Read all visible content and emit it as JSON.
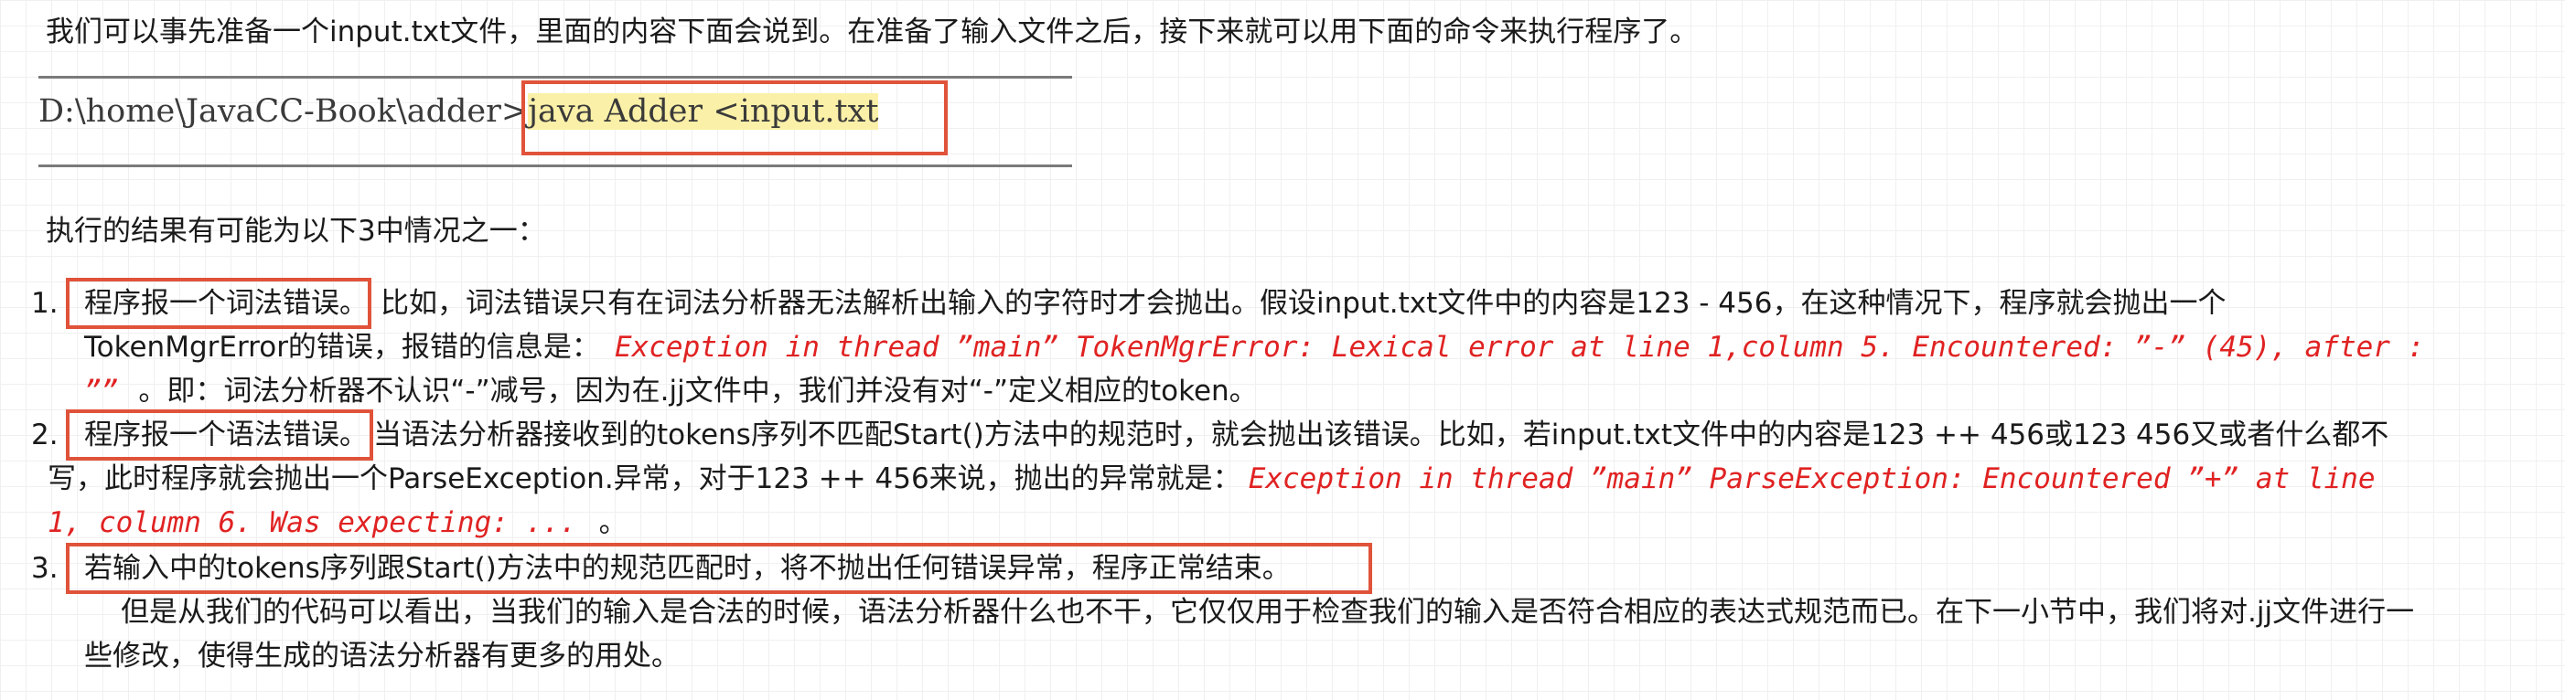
{
  "intro": "我们可以事先准备一个input.txt文件，里面的内容下面会说到。在准备了输入文件之后，接下来就可以用下面的命令来执行程序了。",
  "command": {
    "path": "D:\\home\\JavaCC-Book\\adder>",
    "cmd": "java Adder",
    "arg": "<input.txt"
  },
  "result_intro": "执行的结果有可能为以下3中情况之一：",
  "items": [
    {
      "num": "1.",
      "title": "程序报一个词法错误。",
      "line1": "比如，词法错误只有在词法分析器无法解析出输入的字符时才会抛出。假设input.txt文件中的内容是123 - 456，在这种情况下，程序就会抛出一个",
      "line2_prefix": "TokenMgrError的错误，报错的信息是：",
      "line2_err": "Exception in thread ”main” TokenMgrError: Lexical error at line 1,column 5. Encountered: ”-” (45), after :",
      "line3_err": "””",
      "line3_suffix": "。即：词法分析器不认识“-”减号，因为在.jj文件中，我们并没有对“-”定义相应的token。"
    },
    {
      "num": "2.",
      "title": "程序报一个语法错误。",
      "line1": "当语法分析器接收到的tokens序列不匹配Start()方法中的规范时，就会抛出该错误。比如，若input.txt文件中的内容是123 ++ 456或123 456又或者什么都不",
      "line2_prefix": "写，此时程序就会抛出一个ParseException.异常，对于123 ++ 456来说，抛出的异常就是：",
      "line2_err": "Exception in thread ”main” ParseException: Encountered ”+” at line",
      "line3_err": "1, column 6. Was expecting: ...",
      "line3_suffix": "。"
    },
    {
      "num": "3.",
      "title": "若输入中的tokens序列跟Start()方法中的规范匹配时，将不抛出任何错误异常，程序正常结束。"
    }
  ],
  "closing": {
    "line1": "但是从我们的代码可以看出，当我们的输入是合法的时候，语法分析器什么也不干，它仅仅用于检查我们的输入是否符合相应的表达式规范而已。在下一小节中，我们将对.jj文件进行一",
    "line2": "些修改，使得生成的语法分析器有更多的用处。"
  },
  "colors": {
    "error_text": "#e02222",
    "box_border": "#e0533a",
    "highlight": "#fbf0a8"
  }
}
